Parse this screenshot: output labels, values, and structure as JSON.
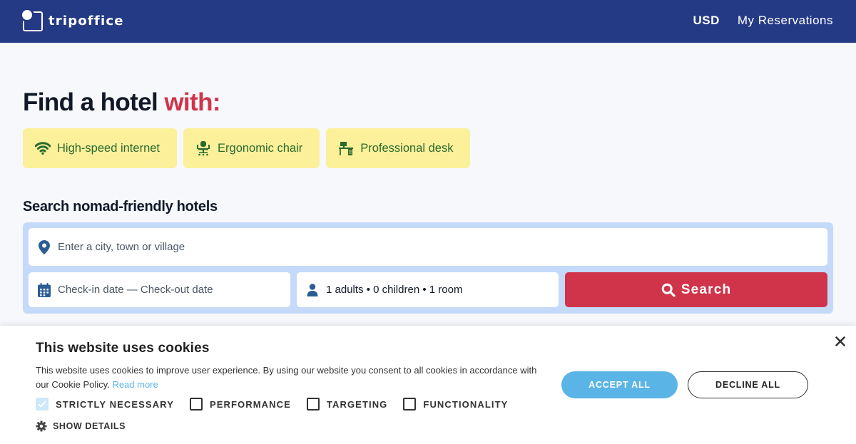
{
  "header": {
    "brand": "tripoffice",
    "currency": "USD",
    "reservations_link": "My Reservations"
  },
  "hero": {
    "headline_main": "Find a hotel ",
    "headline_accent": "with:",
    "features": [
      {
        "label": "High-speed internet",
        "icon": "wifi-icon"
      },
      {
        "label": "Ergonomic chair",
        "icon": "office-chair-icon"
      },
      {
        "label": "Professional desk",
        "icon": "desk-icon"
      }
    ]
  },
  "search": {
    "heading": "Search nomad-friendly hotels",
    "destination_placeholder": "Enter a city, town or village",
    "destination_value": "",
    "dates_label": "Check-in date — Check-out date",
    "guests_label": "1 adults • 0 children • 1 room",
    "search_button": "Search"
  },
  "cookie_banner": {
    "title": "This website uses cookies",
    "text": "This website uses cookies to improve user experience. By using our website you consent to all cookies in accordance with our Cookie Policy.",
    "read_more": "Read more",
    "categories": [
      {
        "label": "STRICTLY NECESSARY",
        "checked": true
      },
      {
        "label": "PERFORMANCE",
        "checked": false
      },
      {
        "label": "TARGETING",
        "checked": false
      },
      {
        "label": "FUNCTIONALITY",
        "checked": false
      }
    ],
    "show_details": "SHOW DETAILS",
    "accept_all": "ACCEPT ALL",
    "decline_all": "DECLINE ALL"
  },
  "colors": {
    "header_bg": "#253a85",
    "accent_red": "#d0344a",
    "feature_bg": "#fcf09a",
    "feature_text": "#2b6a2f",
    "search_panel": "#c5daf9",
    "cookie_blue": "#5ab4e6",
    "icon_blue": "#2b5d94"
  }
}
